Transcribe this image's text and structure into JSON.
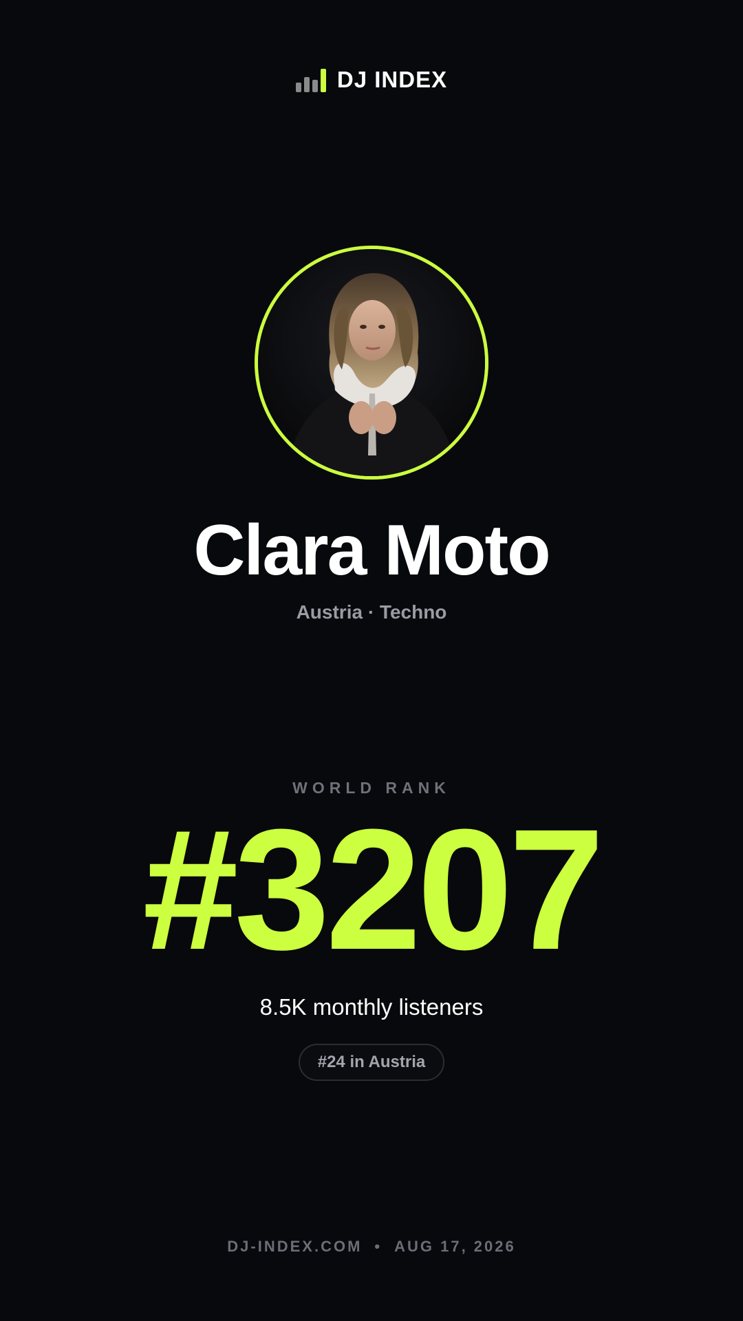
{
  "brand": {
    "name": "DJ INDEX",
    "icon": "bar-chart-icon",
    "accent_color": "#ccff3f",
    "muted_bar_color": "#8a8a8a"
  },
  "artist": {
    "name": "Clara Moto",
    "meta": "Austria · Techno",
    "avatar_icon": "artist-photo"
  },
  "rank": {
    "label": "WORLD RANK",
    "value": "#3207"
  },
  "stats": {
    "listeners": "8.5K monthly listeners",
    "country_rank": "#24 in Austria"
  },
  "footer": {
    "site": "DJ-INDEX.COM",
    "separator": "•",
    "date": "AUG 17, 2026"
  },
  "colors": {
    "background": "#08090c",
    "accent": "#ccff3f",
    "text_primary": "#ffffff",
    "text_muted": "#9a9ba3"
  }
}
